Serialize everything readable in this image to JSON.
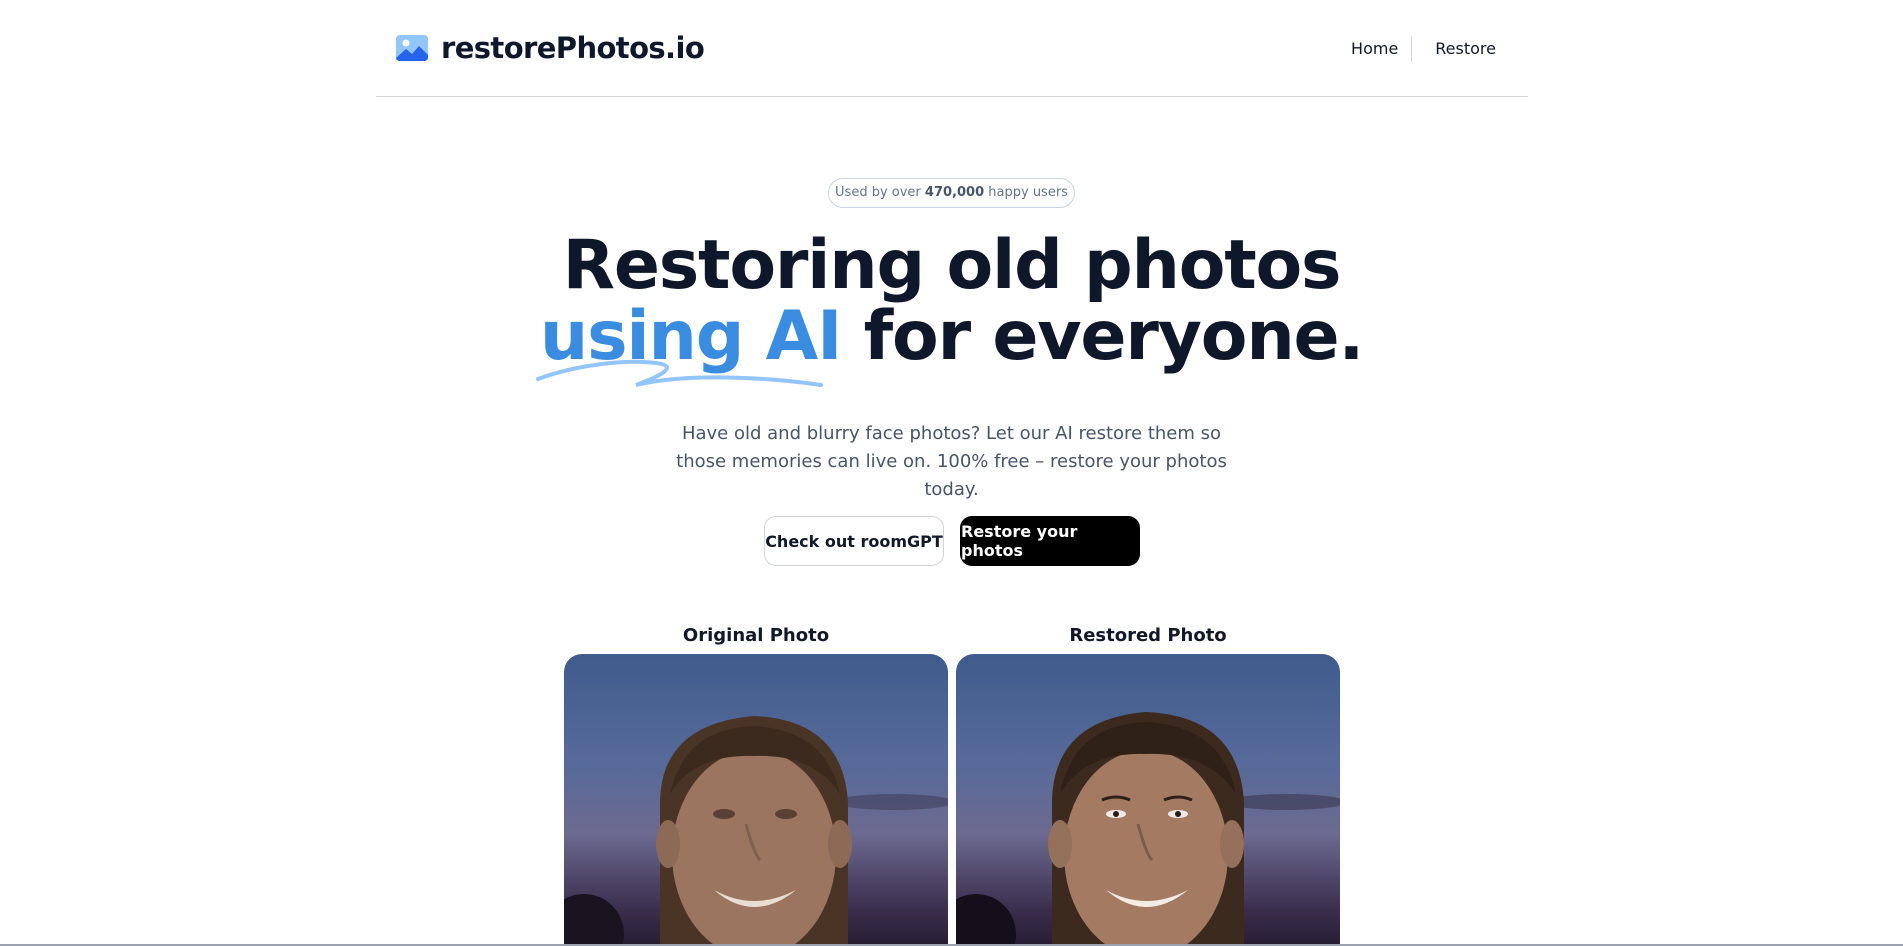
{
  "header": {
    "logo_text": "restorePhotos.io",
    "nav": {
      "home": "Home",
      "restore": "Restore"
    }
  },
  "badge": {
    "prefix": "Used by over",
    "count": "470,000",
    "suffix": "happy users"
  },
  "hero": {
    "line1": "Restoring old photos",
    "accent": "using AI",
    "line2_rest": "for everyone.",
    "subtitle": "Have old and blurry face photos? Let our AI restore them so those memories can live on. 100% free – restore your photos today."
  },
  "buttons": {
    "secondary": "Check out roomGPT",
    "primary": "Restore your photos"
  },
  "comparison": {
    "original_label": "Original Photo",
    "restored_label": "Restored Photo"
  },
  "colors": {
    "accent": "#3a8ce0",
    "text": "#0f172a",
    "muted": "#475569",
    "button_primary": "#000000"
  }
}
